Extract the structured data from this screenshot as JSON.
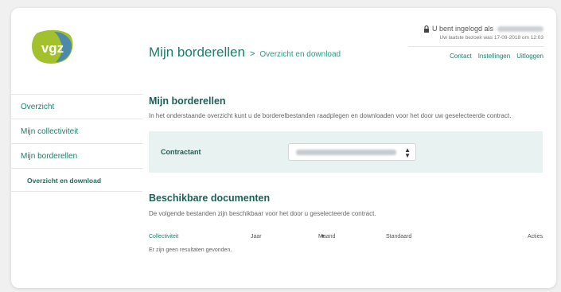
{
  "colors": {
    "brand_teal": "#1c7d6c",
    "heading_dark": "#1c5f55",
    "filter_bg": "#e8f3f1",
    "logo_green": "#a3c12d",
    "logo_blue": "#3d7fc1"
  },
  "logo": {
    "text": "vgz"
  },
  "header": {
    "title": "Mijn borderellen",
    "separator": ">",
    "breadcrumb": "Overzicht en download"
  },
  "user": {
    "logged_in_label": "U bent ingelogd als",
    "last_visit": "Uw laatste bezoek was 17-09-2018 om 12:03",
    "links": [
      "Contact",
      "Instellingen",
      "Uitloggen"
    ]
  },
  "sidebar": {
    "items": [
      {
        "label": "Overzicht"
      },
      {
        "label": "Mijn collectiviteit"
      },
      {
        "label": "Mijn borderellen"
      }
    ],
    "sub_item": "Overzicht en download"
  },
  "main": {
    "section_title": "Mijn borderellen",
    "intro": "In het onderstaande overzicht kunt u de borderelbestanden raadplegen en downloaden voor het door uw geselecteerde contract.",
    "filter_label": "Contractant",
    "docs_title": "Beschikbare documenten",
    "docs_intro": "De volgende bestanden zijn beschikbaar voor het door u geselecteerde contract.",
    "columns": {
      "collectiviteit": "Collectiviteit",
      "jaar": "Jaar",
      "maand": "Maand",
      "standaard": "Standaard",
      "acties": "Acties"
    },
    "no_results": "Er zijn geen resultaten gevonden."
  }
}
